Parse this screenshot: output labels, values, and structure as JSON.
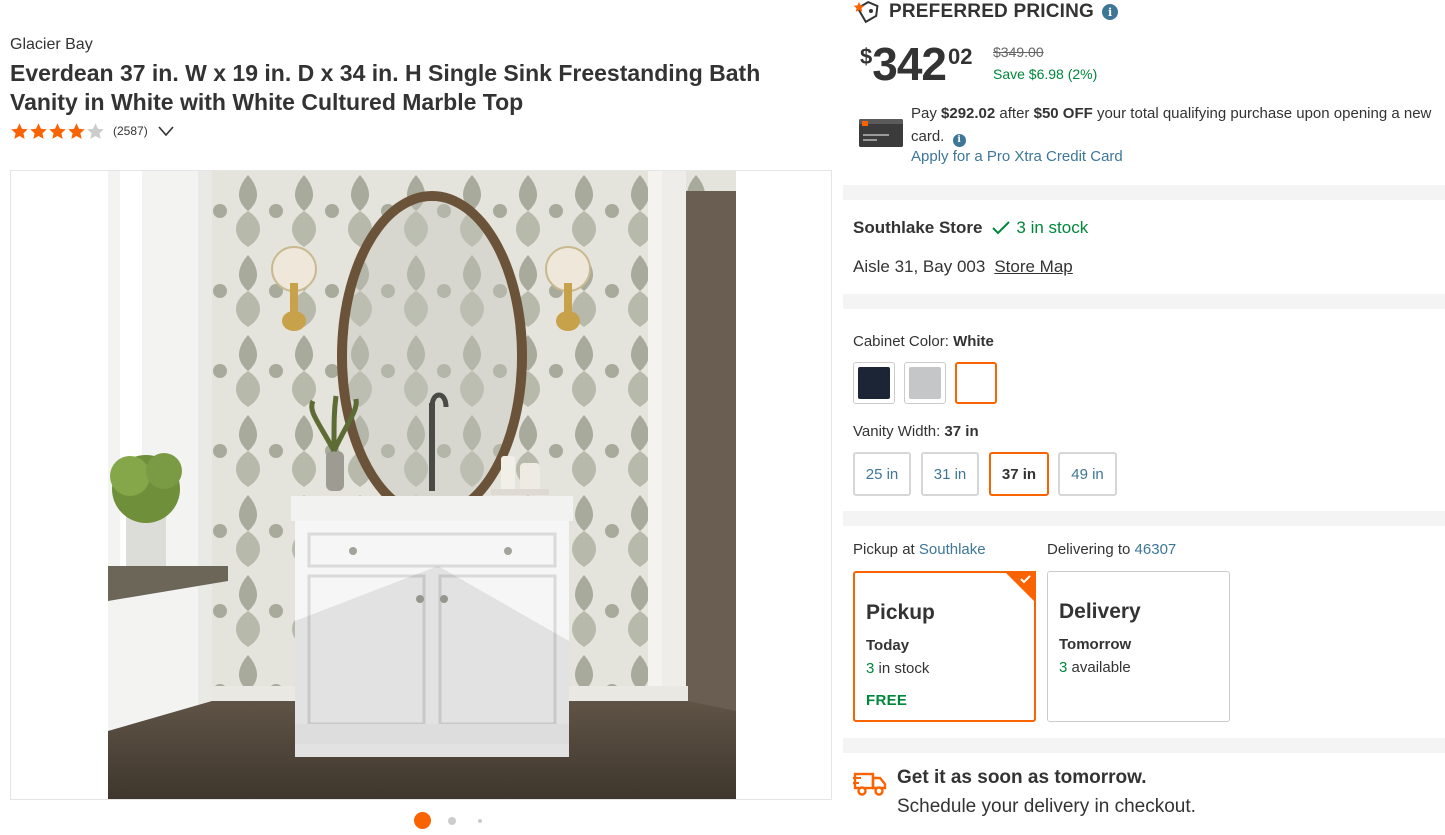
{
  "product": {
    "brand": "Glacier Bay",
    "title": "Everdean 37 in. W x 19 in. D x 34 in. H Single Sink Freestanding Bath Vanity in White with White Cultured Marble Top",
    "rating_stars": 4,
    "rating_out_of": 5,
    "review_count": "(2587)"
  },
  "gallery": {
    "photo_icon": "bathroom-vanity-photo",
    "page_dots": 3,
    "active_dot": 1
  },
  "pricing": {
    "badge_label": "PREFERRED PRICING",
    "currency_symbol": "$",
    "price_dollars": "342",
    "price_cents": "02",
    "was_price": "$349.00",
    "savings": "Save $6.98 (2%)"
  },
  "promo": {
    "pay_prefix": "Pay ",
    "pay_amount": "$292.02",
    "pay_mid": " after ",
    "discount": "$50 OFF",
    "pay_suffix": " your total qualifying purchase upon opening a new card.",
    "apply_link": "Apply for a Pro Xtra Credit Card"
  },
  "store": {
    "name": "Southlake Store",
    "stock": "3 in stock",
    "aisle": "Aisle 31, Bay 003",
    "map_link": "Store Map"
  },
  "options": {
    "color_label": "Cabinet Color: ",
    "color_value": "White",
    "colors": [
      {
        "name": "navy",
        "hex": "#1c2536"
      },
      {
        "name": "gray",
        "hex": "#c5c6c8"
      },
      {
        "name": "white",
        "hex": "#ffffff"
      }
    ],
    "width_label": "Vanity Width: ",
    "width_value": "37 in",
    "widths": [
      "25 in",
      "31 in",
      "37 in",
      "49 in"
    ]
  },
  "fulfillment": {
    "pickup_prefix": "Pickup at ",
    "pickup_store": "Southlake",
    "delivery_prefix": "Delivering to ",
    "delivery_zip": "46307",
    "pickup": {
      "title": "Pickup",
      "when": "Today",
      "count": "3",
      "avail_suffix": " in stock",
      "price": "FREE"
    },
    "delivery": {
      "title": "Delivery",
      "when": "Tomorrow",
      "count": "3",
      "avail_suffix": " available"
    }
  },
  "shipping": {
    "headline": "Get it as soon as tomorrow.",
    "subline": "Schedule your delivery in checkout."
  },
  "colors": {
    "accent": "#f96302",
    "link": "#3e7697",
    "success": "#00873c",
    "text": "#333333"
  }
}
